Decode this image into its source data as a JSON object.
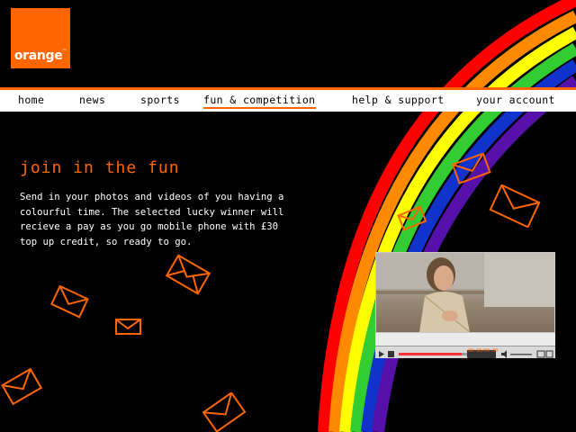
{
  "brand": {
    "logo_text": "orange",
    "logo_mark": "™",
    "color": "#ff6600"
  },
  "nav": {
    "items": [
      {
        "label": "home"
      },
      {
        "label": "news"
      },
      {
        "label": "sports"
      },
      {
        "label": "fun & competition",
        "active": true
      },
      {
        "label": "help & support"
      },
      {
        "label": "your account"
      }
    ]
  },
  "main": {
    "heading": "join in the fun",
    "body_lines": [
      "Send in your photos and videos of you having a",
      "colourful time. The selected lucky winner will",
      "recieve a pay as you go mobile phone with £30",
      "top up credit, so ready to go."
    ]
  },
  "video": {
    "timecode": "00:00/00:30"
  },
  "colors": {
    "background": "#000000",
    "accent": "#ff6600",
    "rainbow": [
      "#ff0000",
      "#ff8a00",
      "#ffff00",
      "#33cc33",
      "#1133cc",
      "#5511aa"
    ]
  },
  "icons": [
    "envelope-icon",
    "play-icon",
    "stop-icon",
    "volume-icon",
    "fullscreen-icon"
  ]
}
